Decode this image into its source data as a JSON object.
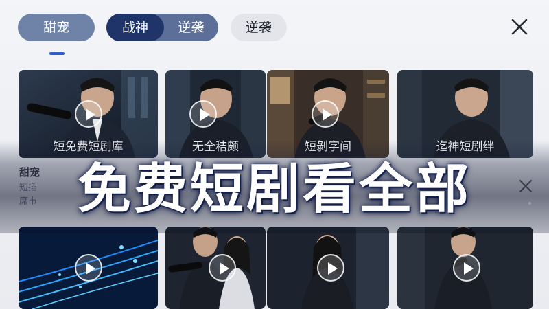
{
  "tabs": {
    "sweet_label": "甜宠",
    "war_god_label": "战神",
    "counterattack_label": "逆袭",
    "counterattack_pill_label": "逆袭",
    "active": "战神"
  },
  "grid": {
    "top_row": [
      {
        "caption": "短免费短剧库",
        "icon": "play-icon"
      },
      {
        "caption": "无全秸颇",
        "icon": "play-icon"
      },
      {
        "caption": "短剝字间",
        "icon": "play-icon"
      },
      {
        "caption": "迄神短剧绊",
        "icon": "play-icon"
      }
    ],
    "bottom_row": [
      {
        "caption": "",
        "icon": "play-icon"
      },
      {
        "caption": "",
        "icon": "play-icon"
      },
      {
        "caption": "",
        "icon": "play-icon"
      },
      {
        "caption": "",
        "icon": "play-icon"
      }
    ]
  },
  "meta": {
    "title": "甜宠",
    "subtitle": "短插",
    "subtitle2": "席市"
  },
  "banner": {
    "headline": "免费短剧看全部"
  },
  "colors": {
    "active_tab": "#1f3569",
    "indicator": "#2f5ed4",
    "pill_muted": "#6f83a8"
  }
}
